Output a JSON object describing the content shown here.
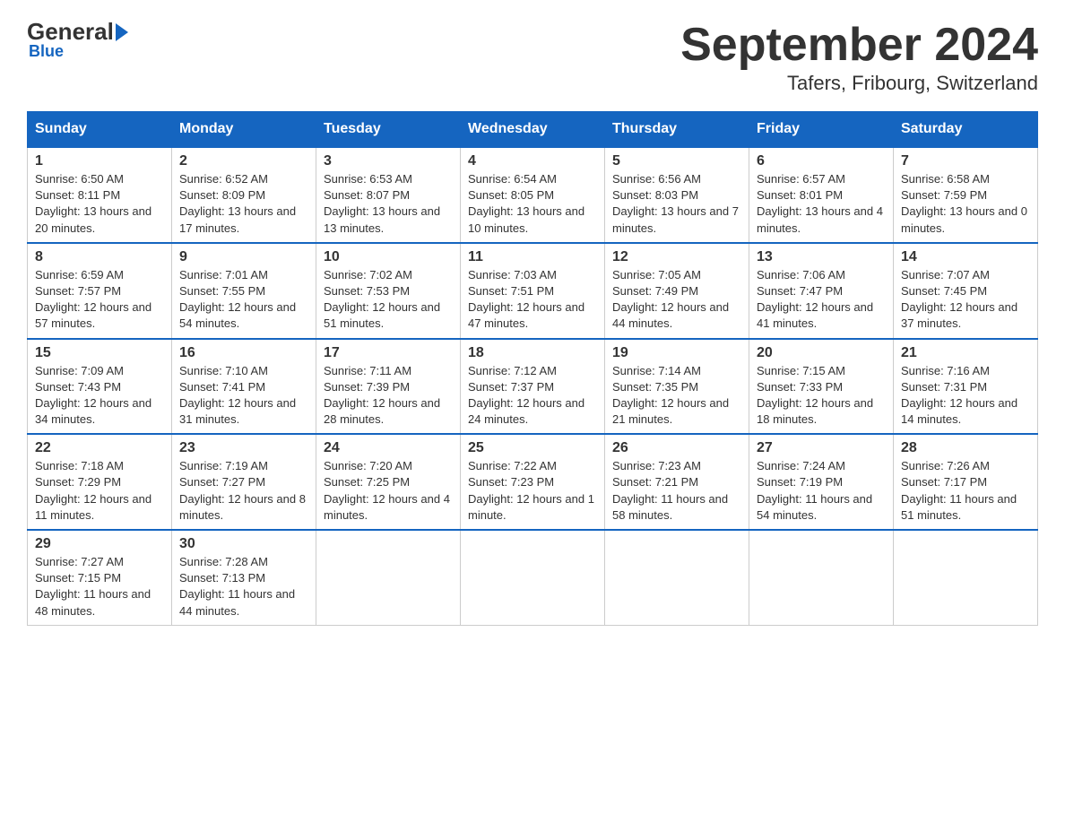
{
  "logo": {
    "text_general": "General",
    "text_blue": "Blue"
  },
  "title": {
    "month_year": "September 2024",
    "location": "Tafers, Fribourg, Switzerland"
  },
  "weekdays": [
    "Sunday",
    "Monday",
    "Tuesday",
    "Wednesday",
    "Thursday",
    "Friday",
    "Saturday"
  ],
  "weeks": [
    [
      {
        "day": "1",
        "sunrise": "6:50 AM",
        "sunset": "8:11 PM",
        "daylight": "13 hours and 20 minutes."
      },
      {
        "day": "2",
        "sunrise": "6:52 AM",
        "sunset": "8:09 PM",
        "daylight": "13 hours and 17 minutes."
      },
      {
        "day": "3",
        "sunrise": "6:53 AM",
        "sunset": "8:07 PM",
        "daylight": "13 hours and 13 minutes."
      },
      {
        "day": "4",
        "sunrise": "6:54 AM",
        "sunset": "8:05 PM",
        "daylight": "13 hours and 10 minutes."
      },
      {
        "day": "5",
        "sunrise": "6:56 AM",
        "sunset": "8:03 PM",
        "daylight": "13 hours and 7 minutes."
      },
      {
        "day": "6",
        "sunrise": "6:57 AM",
        "sunset": "8:01 PM",
        "daylight": "13 hours and 4 minutes."
      },
      {
        "day": "7",
        "sunrise": "6:58 AM",
        "sunset": "7:59 PM",
        "daylight": "13 hours and 0 minutes."
      }
    ],
    [
      {
        "day": "8",
        "sunrise": "6:59 AM",
        "sunset": "7:57 PM",
        "daylight": "12 hours and 57 minutes."
      },
      {
        "day": "9",
        "sunrise": "7:01 AM",
        "sunset": "7:55 PM",
        "daylight": "12 hours and 54 minutes."
      },
      {
        "day": "10",
        "sunrise": "7:02 AM",
        "sunset": "7:53 PM",
        "daylight": "12 hours and 51 minutes."
      },
      {
        "day": "11",
        "sunrise": "7:03 AM",
        "sunset": "7:51 PM",
        "daylight": "12 hours and 47 minutes."
      },
      {
        "day": "12",
        "sunrise": "7:05 AM",
        "sunset": "7:49 PM",
        "daylight": "12 hours and 44 minutes."
      },
      {
        "day": "13",
        "sunrise": "7:06 AM",
        "sunset": "7:47 PM",
        "daylight": "12 hours and 41 minutes."
      },
      {
        "day": "14",
        "sunrise": "7:07 AM",
        "sunset": "7:45 PM",
        "daylight": "12 hours and 37 minutes."
      }
    ],
    [
      {
        "day": "15",
        "sunrise": "7:09 AM",
        "sunset": "7:43 PM",
        "daylight": "12 hours and 34 minutes."
      },
      {
        "day": "16",
        "sunrise": "7:10 AM",
        "sunset": "7:41 PM",
        "daylight": "12 hours and 31 minutes."
      },
      {
        "day": "17",
        "sunrise": "7:11 AM",
        "sunset": "7:39 PM",
        "daylight": "12 hours and 28 minutes."
      },
      {
        "day": "18",
        "sunrise": "7:12 AM",
        "sunset": "7:37 PM",
        "daylight": "12 hours and 24 minutes."
      },
      {
        "day": "19",
        "sunrise": "7:14 AM",
        "sunset": "7:35 PM",
        "daylight": "12 hours and 21 minutes."
      },
      {
        "day": "20",
        "sunrise": "7:15 AM",
        "sunset": "7:33 PM",
        "daylight": "12 hours and 18 minutes."
      },
      {
        "day": "21",
        "sunrise": "7:16 AM",
        "sunset": "7:31 PM",
        "daylight": "12 hours and 14 minutes."
      }
    ],
    [
      {
        "day": "22",
        "sunrise": "7:18 AM",
        "sunset": "7:29 PM",
        "daylight": "12 hours and 11 minutes."
      },
      {
        "day": "23",
        "sunrise": "7:19 AM",
        "sunset": "7:27 PM",
        "daylight": "12 hours and 8 minutes."
      },
      {
        "day": "24",
        "sunrise": "7:20 AM",
        "sunset": "7:25 PM",
        "daylight": "12 hours and 4 minutes."
      },
      {
        "day": "25",
        "sunrise": "7:22 AM",
        "sunset": "7:23 PM",
        "daylight": "12 hours and 1 minute."
      },
      {
        "day": "26",
        "sunrise": "7:23 AM",
        "sunset": "7:21 PM",
        "daylight": "11 hours and 58 minutes."
      },
      {
        "day": "27",
        "sunrise": "7:24 AM",
        "sunset": "7:19 PM",
        "daylight": "11 hours and 54 minutes."
      },
      {
        "day": "28",
        "sunrise": "7:26 AM",
        "sunset": "7:17 PM",
        "daylight": "11 hours and 51 minutes."
      }
    ],
    [
      {
        "day": "29",
        "sunrise": "7:27 AM",
        "sunset": "7:15 PM",
        "daylight": "11 hours and 48 minutes."
      },
      {
        "day": "30",
        "sunrise": "7:28 AM",
        "sunset": "7:13 PM",
        "daylight": "11 hours and 44 minutes."
      },
      null,
      null,
      null,
      null,
      null
    ]
  ]
}
